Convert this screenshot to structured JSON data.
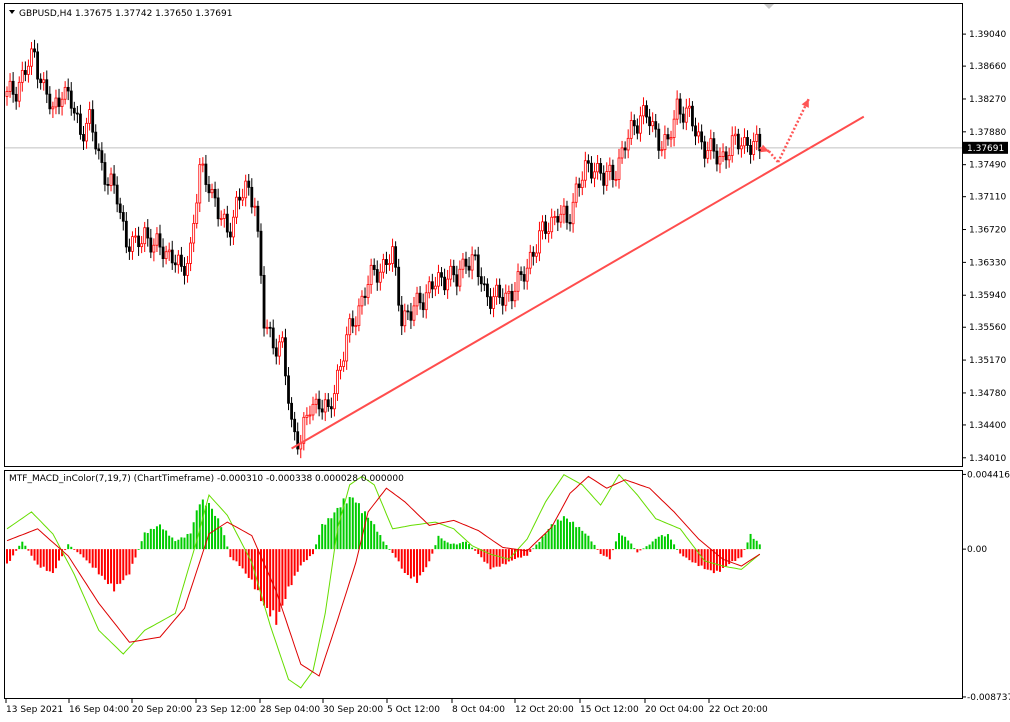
{
  "header": {
    "main_info": "GBPUSD,H4  1.37675 1.37742 1.37650 1.37691",
    "macd_info": "MTF_MACD_inColor(7,19,7) (ChartTimeframe) -0.000310 -0.000338 0.000028 0.000000"
  },
  "chart_data": [
    {
      "type": "candlestick",
      "symbol": "GBPUSD",
      "timeframe": "H4",
      "ohlc_last": [
        1.37675,
        1.37742,
        1.3765,
        1.37691
      ],
      "current_price_label": "1.37691",
      "ylim": [
        1.3396,
        1.3935
      ],
      "y_ticks": [
        "1.39040",
        "1.38660",
        "1.38270",
        "1.37880",
        "1.37490",
        "1.37110",
        "1.36720",
        "1.36330",
        "1.35940",
        "1.35560",
        "1.35170",
        "1.34780",
        "1.34400",
        "1.34010"
      ],
      "x_ticks": [
        "13 Sep 2021",
        "16 Sep 04:00",
        "20 Sep 20:00",
        "23 Sep 12:00",
        "28 Sep 04:00",
        "30 Sep 20:00",
        "5 Oct 12:00",
        "8 Oct 04:00",
        "12 Oct 20:00",
        "15 Oct 12:00",
        "20 Oct 04:00",
        "22 Oct 20:00"
      ],
      "close_path": [
        [
          0,
          1.383
        ],
        [
          3,
          1.384
        ],
        [
          6,
          1.386
        ],
        [
          9,
          1.388
        ],
        [
          12,
          1.384
        ],
        [
          15,
          1.381
        ],
        [
          18,
          1.384
        ],
        [
          21,
          1.382
        ],
        [
          24,
          1.379
        ],
        [
          27,
          1.38
        ],
        [
          30,
          1.376
        ],
        [
          33,
          1.373
        ],
        [
          36,
          1.371
        ],
        [
          39,
          1.366
        ],
        [
          42,
          1.365
        ],
        [
          45,
          1.367
        ],
        [
          48,
          1.365
        ],
        [
          51,
          1.365
        ],
        [
          54,
          1.364
        ],
        [
          57,
          1.362
        ],
        [
          60,
          1.365
        ],
        [
          63,
          1.374
        ],
        [
          66,
          1.373
        ],
        [
          69,
          1.369
        ],
        [
          72,
          1.367
        ],
        [
          75,
          1.37
        ],
        [
          78,
          1.372
        ],
        [
          81,
          1.371
        ],
        [
          84,
          1.356
        ],
        [
          87,
          1.354
        ],
        [
          90,
          1.353
        ],
        [
          93,
          1.344
        ],
        [
          96,
          1.342
        ],
        [
          99,
          1.346
        ],
        [
          102,
          1.347
        ],
        [
          105,
          1.345
        ],
        [
          108,
          1.35
        ],
        [
          111,
          1.354
        ],
        [
          114,
          1.357
        ],
        [
          117,
          1.36
        ],
        [
          120,
          1.362
        ],
        [
          123,
          1.363
        ],
        [
          126,
          1.364
        ],
        [
          129,
          1.357
        ],
        [
          132,
          1.357
        ],
        [
          135,
          1.359
        ],
        [
          138,
          1.36
        ],
        [
          141,
          1.361
        ],
        [
          144,
          1.362
        ],
        [
          147,
          1.361
        ],
        [
          150,
          1.364
        ],
        [
          153,
          1.363
        ],
        [
          156,
          1.36
        ],
        [
          159,
          1.359
        ],
        [
          162,
          1.359
        ],
        [
          165,
          1.36
        ],
        [
          168,
          1.361
        ],
        [
          171,
          1.364
        ],
        [
          174,
          1.366
        ],
        [
          177,
          1.368
        ],
        [
          180,
          1.369
        ],
        [
          183,
          1.368
        ],
        [
          186,
          1.372
        ],
        [
          189,
          1.374
        ],
        [
          192,
          1.375
        ],
        [
          195,
          1.373
        ],
        [
          198,
          1.374
        ],
        [
          201,
          1.376
        ],
        [
          204,
          1.379
        ],
        [
          207,
          1.381
        ],
        [
          210,
          1.38
        ],
        [
          213,
          1.378
        ],
        [
          216,
          1.377
        ],
        [
          219,
          1.382
        ],
        [
          222,
          1.381
        ],
        [
          225,
          1.379
        ],
        [
          228,
          1.377
        ],
        [
          231,
          1.376
        ],
        [
          234,
          1.376
        ],
        [
          237,
          1.377
        ],
        [
          240,
          1.378
        ],
        [
          243,
          1.377
        ],
        [
          246,
          1.3769
        ]
      ],
      "trendline": {
        "x": [
          93,
          280
        ],
        "y": [
          1.3412,
          1.3806
        ]
      },
      "forecast_arrows": [
        {
          "from": [
            246,
            1.3769
          ],
          "to": [
            249,
            1.3765
          ]
        },
        {
          "from": [
            249,
            1.3765
          ],
          "to": [
            252,
            1.3752
          ]
        },
        {
          "from": [
            252,
            1.3752
          ],
          "to": [
            262,
            1.3827
          ]
        }
      ],
      "colors": {
        "bull": "#ff0000",
        "bear": "#000000",
        "trendline": "#ff4d4d",
        "hline": "#c0c0c0"
      }
    },
    {
      "type": "histogram+lines",
      "name": "MTF_MACD_inColor(7,19,7) (ChartTimeframe)",
      "values_last": [
        -0.00031,
        -0.000338,
        2.8e-05,
        0.0
      ],
      "ylim": [
        -0.00874,
        0.0045
      ],
      "y_ticks": [
        "0.004416",
        "0.00",
        "-0.008737"
      ],
      "histogram": [
        [
          0,
          -0.001
        ],
        [
          5,
          0.0005
        ],
        [
          10,
          -0.001
        ],
        [
          15,
          -0.0015
        ],
        [
          20,
          0.0003
        ],
        [
          25,
          -0.0005
        ],
        [
          30,
          -0.0015
        ],
        [
          35,
          -0.0025
        ],
        [
          40,
          -0.0015
        ],
        [
          45,
          0.001
        ],
        [
          50,
          0.0015
        ],
        [
          55,
          0.0005
        ],
        [
          60,
          0.001
        ],
        [
          63,
          0.003
        ],
        [
          66,
          0.0028
        ],
        [
          70,
          0.0015
        ],
        [
          73,
          -0.0005
        ],
        [
          76,
          -0.001
        ],
        [
          80,
          -0.002
        ],
        [
          84,
          -0.0035
        ],
        [
          88,
          -0.0045
        ],
        [
          92,
          -0.0025
        ],
        [
          96,
          -0.001
        ],
        [
          100,
          -0.0003
        ],
        [
          103,
          0.0015
        ],
        [
          106,
          0.002
        ],
        [
          110,
          0.003
        ],
        [
          113,
          0.0032
        ],
        [
          116,
          0.0025
        ],
        [
          120,
          0.0015
        ],
        [
          123,
          0.0005
        ],
        [
          127,
          -0.0005
        ],
        [
          130,
          -0.0015
        ],
        [
          134,
          -0.002
        ],
        [
          138,
          -0.0008
        ],
        [
          141,
          0.0008
        ],
        [
          144,
          0.0004
        ],
        [
          147,
          0.0003
        ],
        [
          150,
          0.0005
        ],
        [
          154,
          -0.0003
        ],
        [
          158,
          -0.0012
        ],
        [
          162,
          -0.001
        ],
        [
          166,
          -0.0006
        ],
        [
          170,
          -0.0004
        ],
        [
          174,
          0.0005
        ],
        [
          178,
          0.0015
        ],
        [
          182,
          0.002
        ],
        [
          186,
          0.0015
        ],
        [
          190,
          0.0008
        ],
        [
          194,
          -0.0003
        ],
        [
          197,
          -0.0006
        ],
        [
          200,
          0.001
        ],
        [
          203,
          0.0006
        ],
        [
          206,
          -0.0002
        ],
        [
          210,
          0.0003
        ],
        [
          213,
          0.0008
        ],
        [
          216,
          0.0009
        ],
        [
          220,
          -0.0003
        ],
        [
          224,
          -0.0008
        ],
        [
          228,
          -0.0012
        ],
        [
          232,
          -0.0015
        ],
        [
          236,
          -0.0009
        ],
        [
          240,
          -0.0005
        ],
        [
          243,
          0.0009
        ],
        [
          246,
          0.0003
        ]
      ],
      "line_green": [
        [
          0,
          0.0012
        ],
        [
          8,
          0.0022
        ],
        [
          15,
          0.0009
        ],
        [
          22,
          -0.0015
        ],
        [
          30,
          -0.0048
        ],
        [
          38,
          -0.0062
        ],
        [
          45,
          -0.0048
        ],
        [
          55,
          -0.0038
        ],
        [
          62,
          0.0005
        ],
        [
          66,
          0.0032
        ],
        [
          72,
          0.002
        ],
        [
          80,
          -0.0008
        ],
        [
          86,
          -0.0045
        ],
        [
          92,
          -0.0077
        ],
        [
          96,
          -0.0082
        ],
        [
          100,
          -0.0072
        ],
        [
          104,
          -0.0038
        ],
        [
          108,
          0.0012
        ],
        [
          112,
          0.0038
        ],
        [
          116,
          0.0043
        ],
        [
          120,
          0.0038
        ],
        [
          126,
          0.0012
        ],
        [
          132,
          0.0014
        ],
        [
          140,
          0.0016
        ],
        [
          146,
          0.0012
        ],
        [
          152,
          0.0002
        ],
        [
          158,
          -0.0003
        ],
        [
          164,
          -0.0006
        ],
        [
          170,
          0.0006
        ],
        [
          176,
          0.0028
        ],
        [
          182,
          0.0044
        ],
        [
          188,
          0.0038
        ],
        [
          194,
          0.0026
        ],
        [
          200,
          0.0044
        ],
        [
          206,
          0.0032
        ],
        [
          212,
          0.0018
        ],
        [
          220,
          0.0012
        ],
        [
          228,
          -0.0007
        ],
        [
          234,
          -0.001
        ],
        [
          240,
          -0.0012
        ],
        [
          246,
          -0.0003
        ]
      ],
      "line_red": [
        [
          0,
          0.0005
        ],
        [
          10,
          0.0012
        ],
        [
          20,
          -0.0004
        ],
        [
          30,
          -0.0032
        ],
        [
          40,
          -0.0055
        ],
        [
          50,
          -0.0052
        ],
        [
          58,
          -0.0035
        ],
        [
          66,
          0.0009
        ],
        [
          72,
          0.0016
        ],
        [
          80,
          0.0008
        ],
        [
          88,
          -0.0025
        ],
        [
          96,
          -0.0068
        ],
        [
          102,
          -0.0075
        ],
        [
          108,
          -0.0042
        ],
        [
          114,
          -0.0008
        ],
        [
          118,
          0.0022
        ],
        [
          124,
          0.0036
        ],
        [
          130,
          0.0028
        ],
        [
          138,
          0.0014
        ],
        [
          146,
          0.0017
        ],
        [
          154,
          0.0011
        ],
        [
          162,
          0.0001
        ],
        [
          170,
          -0.0001
        ],
        [
          178,
          0.0013
        ],
        [
          184,
          0.0033
        ],
        [
          190,
          0.0043
        ],
        [
          196,
          0.0036
        ],
        [
          202,
          0.0041
        ],
        [
          210,
          0.0036
        ],
        [
          218,
          0.0022
        ],
        [
          226,
          0.0006
        ],
        [
          234,
          -0.0006
        ],
        [
          240,
          -0.001
        ],
        [
          246,
          -0.0003
        ]
      ],
      "colors": {
        "hist_pos": "#00cc00",
        "hist_neg": "#ff0000",
        "line_green": "#66dd00",
        "line_red": "#dd0000"
      }
    }
  ]
}
